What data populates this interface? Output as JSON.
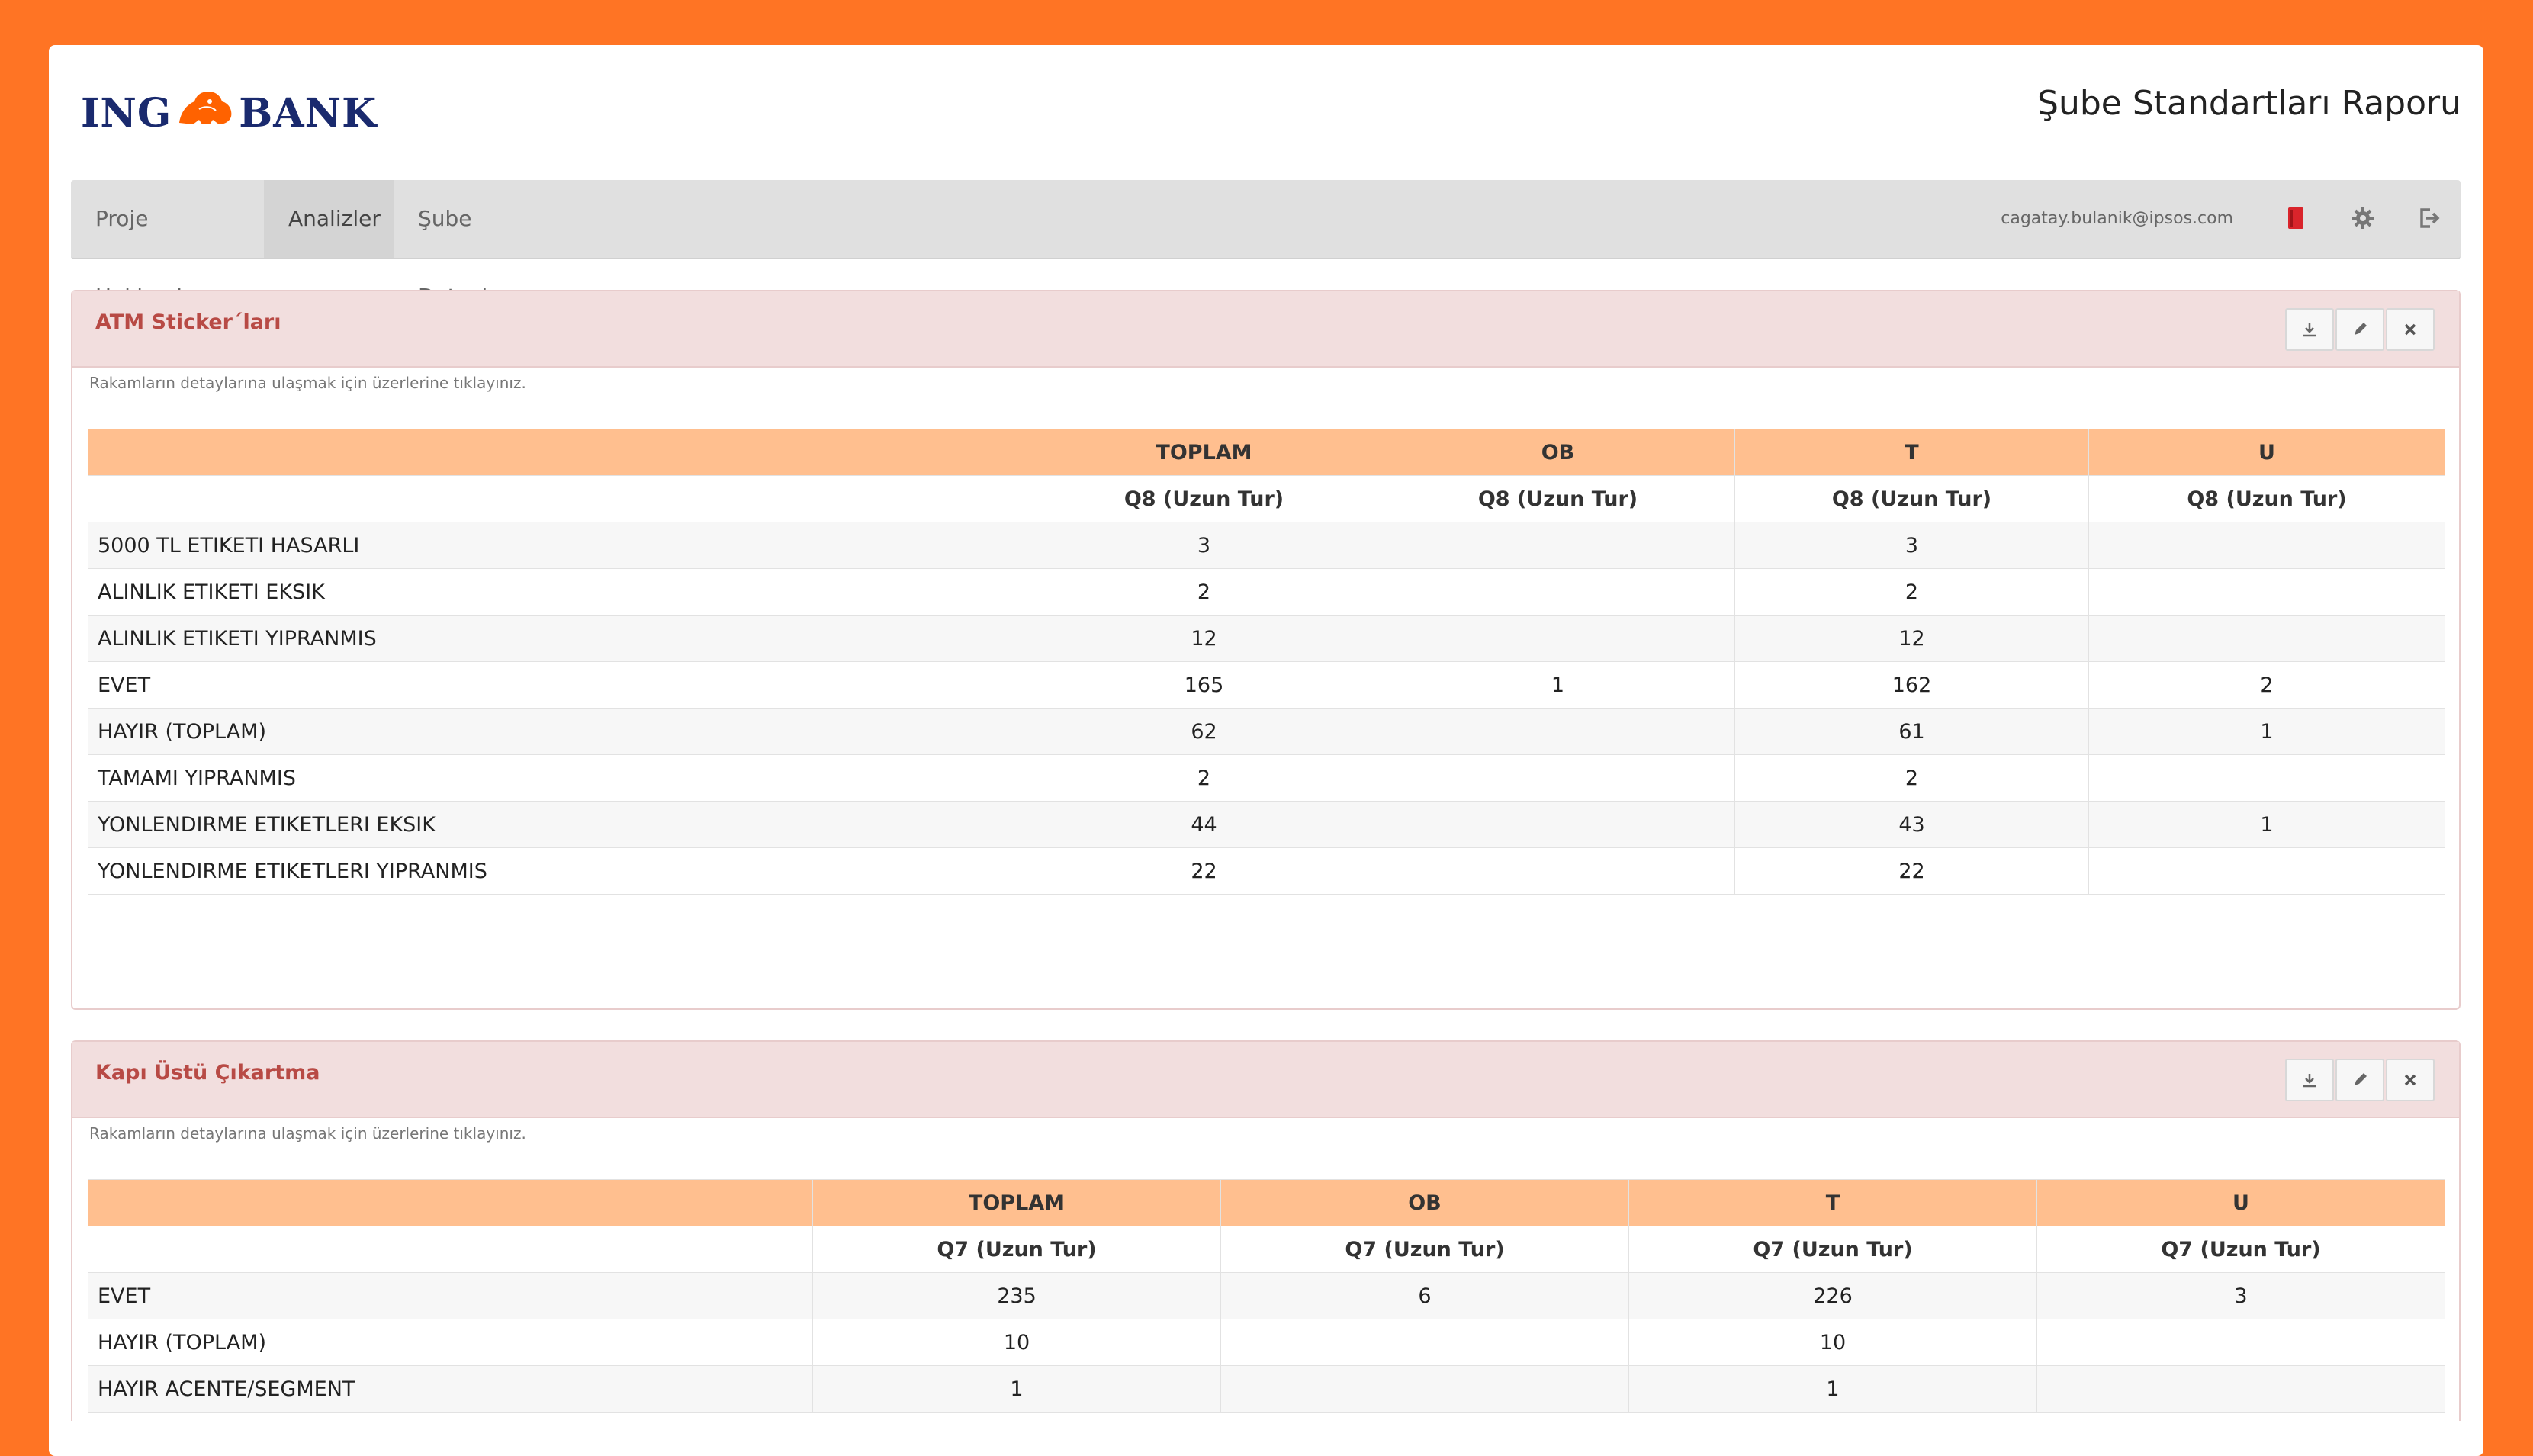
{
  "brand": {
    "left": "ING",
    "right": "BANK",
    "orange": "#ff7424",
    "navy": "#1a2a6e"
  },
  "header": {
    "report_title": "Şube Standartları Raporu"
  },
  "nav": {
    "items": [
      "Proje Hakkında",
      "Analizler",
      "Şube Detayları"
    ],
    "active": "Analizler",
    "email": "cagatay.bulanik@ipsos.com",
    "icons": [
      "book-icon",
      "gear-icon",
      "logout-icon"
    ]
  },
  "panels": [
    {
      "title": "ATM Sticker´ları",
      "hint": "Rakamların detaylarına ulaşmak için üzerlerine tıklayınız.",
      "columns": [
        "TOPLAM",
        "OB",
        "T",
        "U"
      ],
      "subheaders": [
        "Q8 (Uzun Tur)",
        "Q8 (Uzun Tur)",
        "Q8 (Uzun Tur)",
        "Q8 (Uzun Tur)"
      ],
      "rows": [
        {
          "label": "5000 TL ETIKETI HASARLI",
          "values": [
            "3",
            "",
            "3",
            ""
          ]
        },
        {
          "label": "ALINLIK ETIKETI EKSIK",
          "values": [
            "2",
            "",
            "2",
            ""
          ]
        },
        {
          "label": "ALINLIK ETIKETI YIPRANMIS",
          "values": [
            "12",
            "",
            "12",
            ""
          ]
        },
        {
          "label": "EVET",
          "values": [
            "165",
            "1",
            "162",
            "2"
          ]
        },
        {
          "label": "HAYIR (TOPLAM)",
          "values": [
            "62",
            "",
            "61",
            "1"
          ]
        },
        {
          "label": "TAMAMI YIPRANMIS",
          "values": [
            "2",
            "",
            "2",
            ""
          ]
        },
        {
          "label": "YONLENDIRME ETIKETLERI EKSIK",
          "values": [
            "44",
            "",
            "43",
            "1"
          ]
        },
        {
          "label": "YONLENDIRME ETIKETLERI YIPRANMIS",
          "values": [
            "22",
            "",
            "22",
            ""
          ]
        }
      ]
    },
    {
      "title": "Kapı Üstü Çıkartma",
      "hint": "Rakamların detaylarına ulaşmak için üzerlerine tıklayınız.",
      "columns": [
        "TOPLAM",
        "OB",
        "T",
        "U"
      ],
      "subheaders": [
        "Q7 (Uzun Tur)",
        "Q7 (Uzun Tur)",
        "Q7 (Uzun Tur)",
        "Q7 (Uzun Tur)"
      ],
      "rows": [
        {
          "label": "EVET",
          "values": [
            "235",
            "6",
            "226",
            "3"
          ]
        },
        {
          "label": "HAYIR (TOPLAM)",
          "values": [
            "10",
            "",
            "10",
            ""
          ]
        },
        {
          "label": "HAYIR ACENTE/SEGMENT",
          "values": [
            "1",
            "",
            "1",
            ""
          ]
        }
      ]
    }
  ]
}
